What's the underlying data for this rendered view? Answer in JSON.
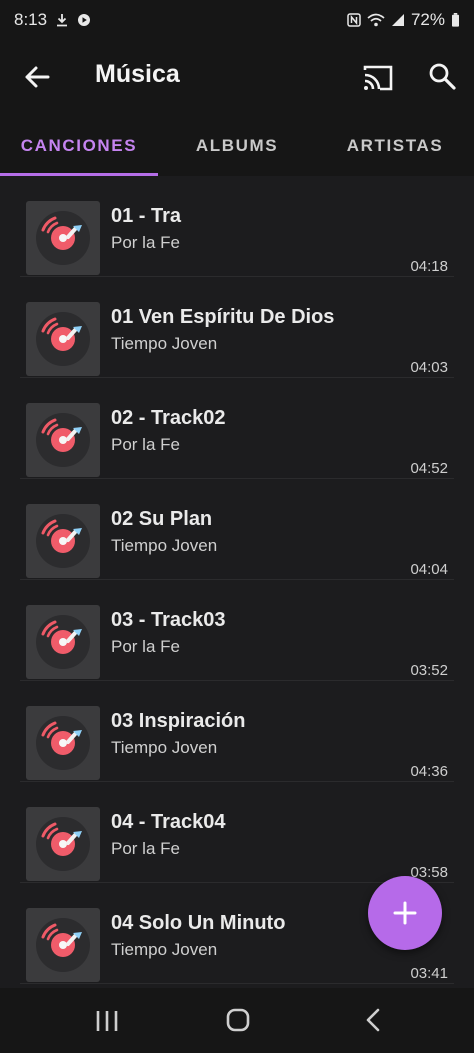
{
  "status": {
    "time": "8:13",
    "battery": "72%"
  },
  "appbar": {
    "title": "Música"
  },
  "tabs": [
    {
      "label": "CANCIONES"
    },
    {
      "label": "ALBUMS"
    },
    {
      "label": "ARTISTAS"
    }
  ],
  "songs": [
    {
      "title": "01 - Tra",
      "artist": "Por la Fe",
      "duration": "04:18"
    },
    {
      "title": "01 Ven Espíritu De Dios",
      "artist": "Tiempo Joven",
      "duration": "04:03"
    },
    {
      "title": "02 - Track02",
      "artist": "Por la Fe",
      "duration": "04:52"
    },
    {
      "title": "02 Su Plan",
      "artist": "Tiempo Joven",
      "duration": "04:04"
    },
    {
      "title": "03 - Track03",
      "artist": "Por la Fe",
      "duration": "03:52"
    },
    {
      "title": "03 Inspiración",
      "artist": "Tiempo Joven",
      "duration": "04:36"
    },
    {
      "title": "04 - Track04",
      "artist": "Por la Fe",
      "duration": "03:58"
    },
    {
      "title": "04 Solo Un Minuto",
      "artist": "Tiempo Joven",
      "duration": "03:41"
    }
  ],
  "colors": {
    "accent": "#b66ae9",
    "background": "#1c1c1e"
  },
  "icons": {
    "back": "arrow-left-icon",
    "cast": "cast-icon",
    "search": "search-icon",
    "album_art": "vinyl-record-icon",
    "fab": "plus-icon"
  }
}
